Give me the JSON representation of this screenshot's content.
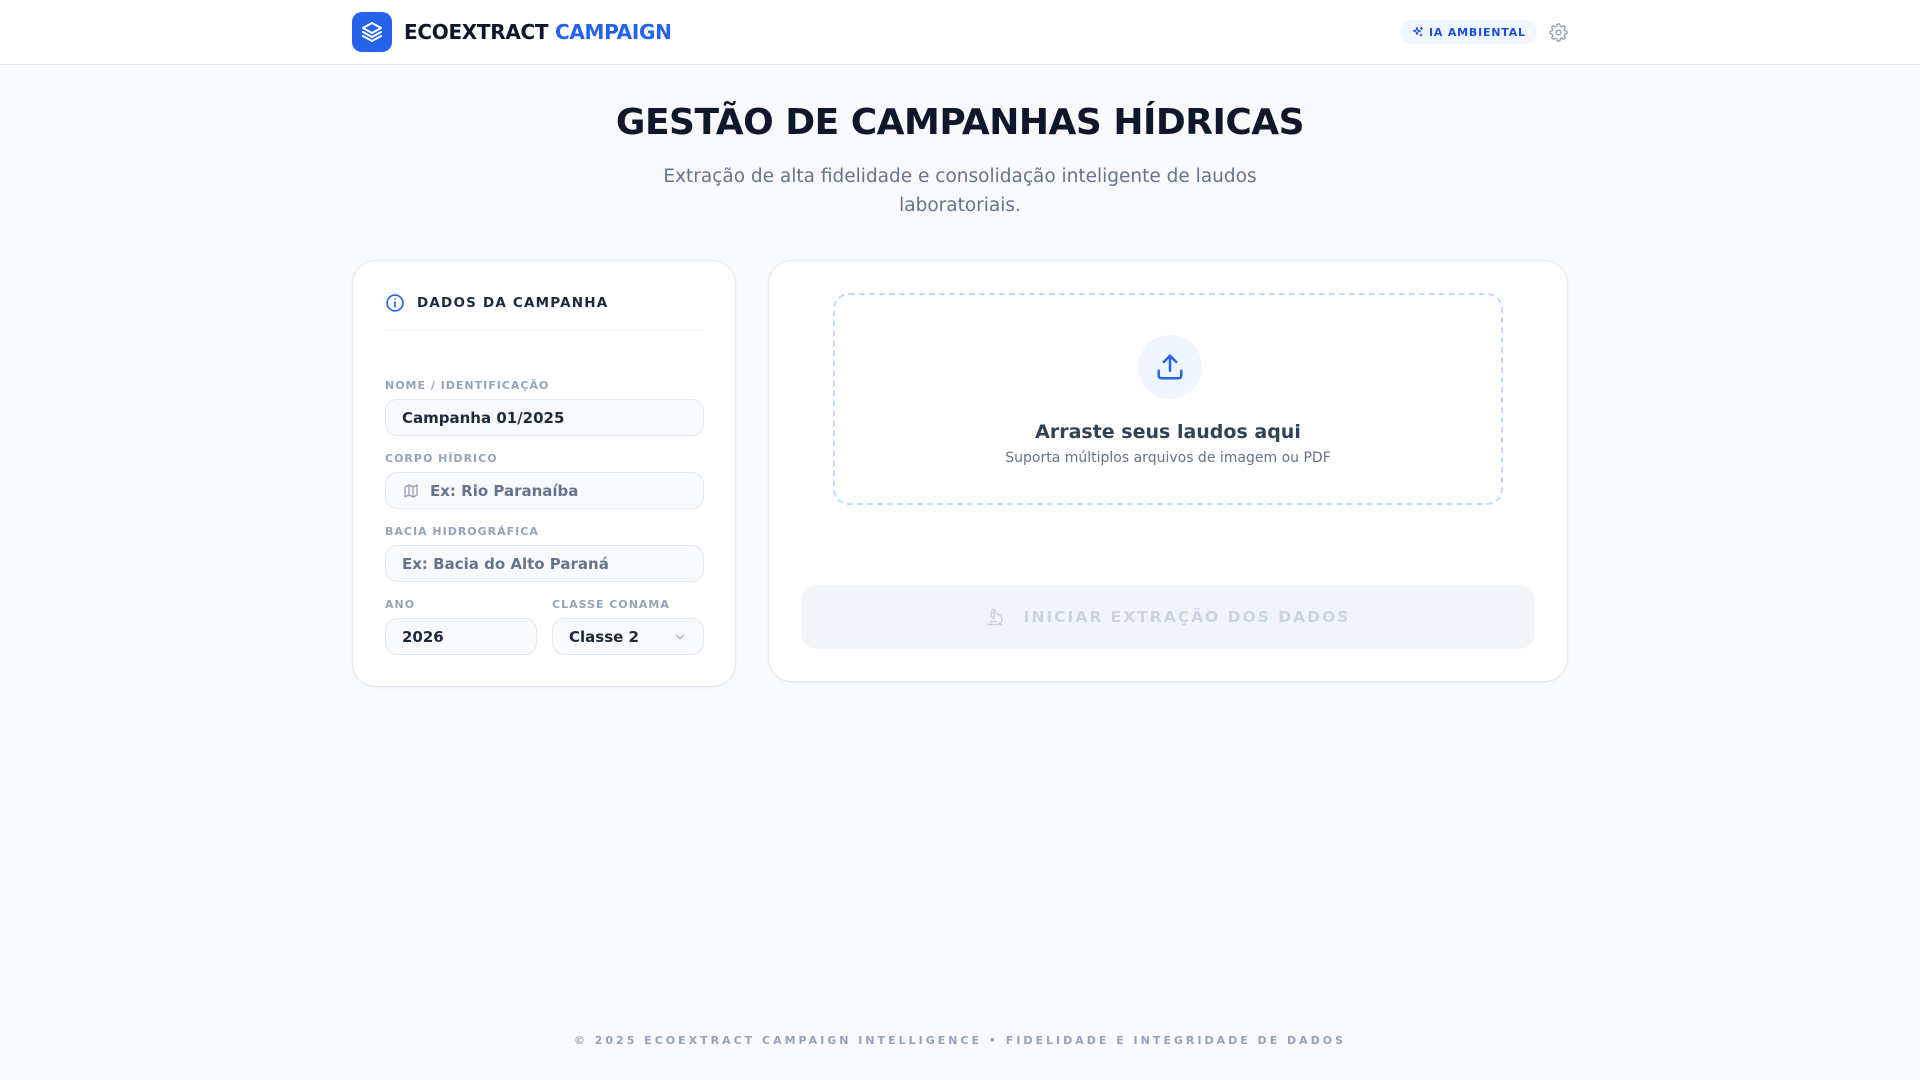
{
  "header": {
    "brand_primary": "ECOEXTRACT",
    "brand_accent": "CAMPAIGN",
    "logo_icon": "layers-icon",
    "badge_label": "IA AMBIENTAL",
    "badge_icon": "sparkles-icon",
    "settings_icon": "gear-icon",
    "accent_color": "#2563eb"
  },
  "hero": {
    "title": "GESTÃO DE CAMPANHAS HÍDRICAS",
    "subtitle": "Extração de alta fidelidade e consolidação inteligente de laudos laboratoriais."
  },
  "campaign_form": {
    "section_title": "DADOS DA CAMPANHA",
    "section_icon": "info-icon",
    "name_label": "NOME / IDENTIFICAÇÃO",
    "name_value": "Campanha 01/2025",
    "water_body_label": "CORPO HÍDRICO",
    "water_body_placeholder": "Ex: Rio Paranaíba",
    "water_body_icon": "map-icon",
    "basin_label": "BACIA HIDROGRÁFICA",
    "basin_placeholder": "Ex: Bacia do Alto Paraná",
    "year_label": "ANO",
    "year_value": "2026",
    "class_label": "CLASSE CONAMA",
    "class_value": "Classe 2",
    "class_icon": "chevron-down-icon"
  },
  "upload": {
    "icon": "upload-icon",
    "title": "Arraste seus laudos aqui",
    "subtitle": "Suporta múltiplos arquivos de imagem ou PDF"
  },
  "action": {
    "label": "INICIAR EXTRAÇÃO DOS DADOS",
    "icon": "microscope-icon",
    "state": "disabled"
  },
  "footer": {
    "text": "© 2025 ECOEXTRACT CAMPAIGN INTELLIGENCE • FIDELIDADE E INTEGRIDADE DE DADOS"
  }
}
